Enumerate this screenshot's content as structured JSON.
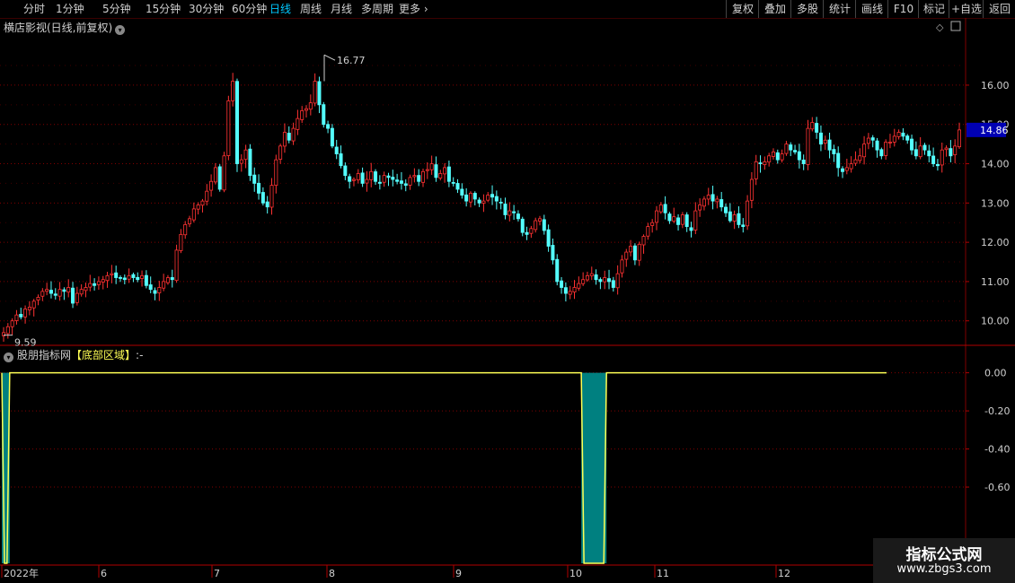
{
  "toolbar": {
    "left": [
      {
        "label": "分时",
        "active": false
      },
      {
        "label": "1分钟",
        "active": false
      },
      {
        "label": "5分钟",
        "active": false
      },
      {
        "label": "15分钟",
        "active": false
      },
      {
        "label": "30分钟",
        "active": false
      },
      {
        "label": "60分钟",
        "active": false
      },
      {
        "label": "日线",
        "active": true
      },
      {
        "label": "周线",
        "active": false
      },
      {
        "label": "月线",
        "active": false
      },
      {
        "label": "多周期",
        "active": false
      },
      {
        "label": "更多",
        "active": false
      }
    ],
    "right": [
      "复权",
      "叠加",
      "多股",
      "统计",
      "画线",
      "F10",
      "标记",
      "+自选",
      "返回"
    ]
  },
  "main_title": "横店影视(日线,前复权)",
  "sub_title": {
    "prefix": "股朋指标网",
    "highlight": "【底部区域】",
    "suffix": ":-"
  },
  "price_axis": {
    "ticks": [
      "16.00",
      "15.00",
      "14.00",
      "13.00",
      "12.00",
      "11.00",
      "10.00"
    ],
    "current": "14.86"
  },
  "sub_axis": {
    "ticks": [
      "0.00",
      "-0.20",
      "-0.40",
      "-0.60"
    ]
  },
  "annotations": {
    "high": "16.77",
    "low": "9.59"
  },
  "x_axis": {
    "labels": [
      "2022年",
      "6",
      "7",
      "8",
      "9",
      "10",
      "11",
      "12"
    ]
  },
  "watermark": {
    "line1": "指标公式网",
    "line2": "www.zbgs3.com"
  },
  "colors": {
    "up": "#ff3232",
    "down": "#54ffff",
    "bg": "#000000",
    "grid": "#800000",
    "indicator": "#ffff54",
    "fill": "#008080"
  },
  "chart_data": [
    {
      "type": "candlestick",
      "title": "横店影视(日线,前复权)",
      "ylim": [
        9.4,
        17.3
      ],
      "close": [
        9.7,
        9.85,
        10.0,
        10.15,
        10.1,
        10.3,
        10.35,
        10.5,
        10.6,
        10.75,
        10.8,
        10.7,
        10.65,
        10.8,
        10.75,
        10.85,
        10.45,
        10.7,
        10.8,
        10.85,
        10.95,
        10.9,
        11.0,
        11.05,
        11.15,
        11.2,
        11.1,
        11.1,
        11.05,
        11.15,
        11.1,
        11.05,
        11.15,
        10.9,
        10.8,
        10.7,
        10.85,
        11.0,
        11.1,
        11.05,
        11.8,
        12.2,
        12.45,
        12.6,
        12.85,
        12.95,
        13.05,
        13.3,
        13.55,
        13.9,
        13.35,
        14.2,
        15.6,
        16.1,
        14.0,
        14.1,
        14.35,
        13.7,
        13.5,
        13.25,
        13.0,
        12.9,
        13.45,
        14.1,
        14.45,
        14.8,
        14.6,
        14.9,
        15.15,
        15.35,
        15.4,
        15.55,
        16.1,
        15.5,
        15.0,
        14.9,
        14.45,
        14.25,
        13.95,
        13.7,
        13.55,
        13.6,
        13.75,
        13.5,
        13.6,
        13.8,
        13.55,
        13.5,
        13.7,
        13.65,
        13.6,
        13.55,
        13.5,
        13.45,
        13.65,
        13.7,
        13.55,
        13.8,
        13.85,
        14.0,
        13.65,
        13.75,
        13.9,
        13.55,
        13.5,
        13.35,
        13.2,
        13.05,
        13.25,
        13.1,
        13.0,
        13.05,
        13.2,
        13.15,
        13.05,
        13.0,
        12.7,
        12.8,
        12.75,
        12.6,
        12.25,
        12.2,
        12.35,
        12.55,
        12.6,
        12.3,
        11.9,
        11.55,
        11.0,
        10.85,
        10.7,
        10.75,
        10.85,
        10.95,
        11.05,
        11.15,
        11.2,
        11.05,
        11.0,
        11.1,
        11.0,
        10.85,
        11.2,
        11.55,
        11.75,
        11.9,
        11.55,
        11.95,
        12.15,
        12.4,
        12.5,
        12.8,
        12.95,
        12.75,
        12.55,
        12.65,
        12.45,
        12.7,
        12.4,
        12.3,
        12.8,
        12.95,
        13.1,
        13.2,
        13.05,
        13.1,
        12.9,
        12.75,
        12.55,
        12.7,
        12.45,
        12.4,
        13.05,
        13.6,
        14.05,
        14.0,
        14.05,
        14.2,
        14.3,
        14.1,
        14.25,
        14.5,
        14.35,
        14.3,
        14.1,
        14.0,
        14.9,
        15.05,
        14.8,
        14.5,
        14.6,
        14.35,
        14.25,
        13.9,
        13.8,
        13.9,
        14.0,
        14.1,
        14.2,
        14.5,
        14.65,
        14.6,
        14.35,
        14.2,
        14.55,
        14.55,
        14.7,
        14.8,
        14.7,
        14.6,
        14.35,
        14.2,
        14.45,
        14.35,
        14.2,
        14.0,
        13.95,
        14.35,
        14.4,
        14.2,
        14.45,
        14.86
      ],
      "y_ticks": [
        "16.00",
        "15.00",
        "14.00",
        "13.00",
        "12.00",
        "11.00",
        "10.00"
      ],
      "annotations": [
        {
          "label": "16.77",
          "type": "high"
        },
        {
          "label": "9.59",
          "type": "low"
        }
      ],
      "x_labels": [
        "2022年",
        "6",
        "7",
        "8",
        "9",
        "10",
        "11",
        "12"
      ]
    },
    {
      "type": "step",
      "title": "底部区域",
      "ylim": [
        -1.0,
        0.05
      ],
      "y_ticks": [
        "0.00",
        "-0.20",
        "-0.40",
        "-0.60"
      ],
      "signal_segments": [
        {
          "from": 0,
          "to": 1,
          "value": -1.0
        },
        {
          "from": 134,
          "to": 139,
          "value": -1.0
        }
      ],
      "baseline": 0.0
    }
  ]
}
